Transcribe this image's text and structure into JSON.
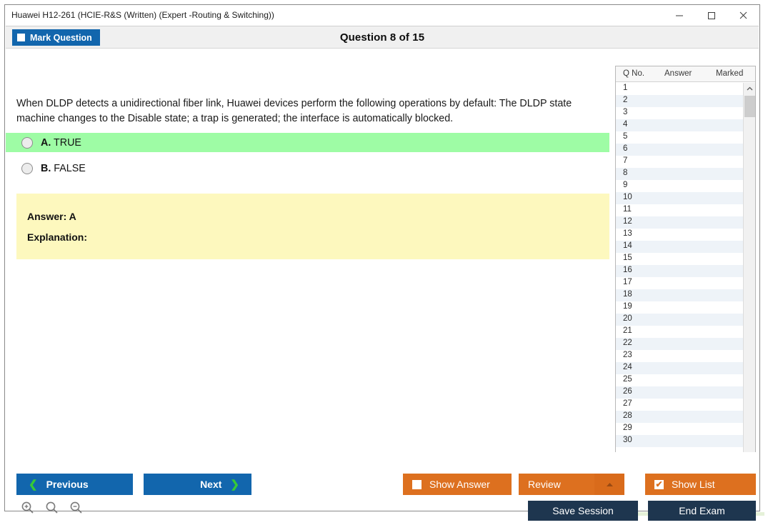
{
  "window": {
    "title": "Huawei H12-261 (HCIE-R&S (Written) (Expert -Routing & Switching))",
    "controls": {
      "minimize": "minimize-icon",
      "maximize": "maximize-icon",
      "close": "close-icon"
    }
  },
  "header": {
    "mark_question_label": "Mark Question",
    "question_counter": "Question 8 of 15"
  },
  "question": {
    "text": "When DLDP detects a unidirectional fiber link, Huawei devices perform the following operations by default: The DLDP state machine changes to the Disable state; a trap is generated; the interface is automatically blocked.",
    "options": [
      {
        "letter": "A.",
        "text": "TRUE",
        "selected": false,
        "highlight": "correct"
      },
      {
        "letter": "B.",
        "text": "FALSE",
        "selected": false,
        "highlight": "none"
      }
    ],
    "answer_line": "Answer: A",
    "explanation_line": "Explanation:"
  },
  "list_panel": {
    "columns": [
      "Q No.",
      "Answer",
      "Marked"
    ],
    "rows": [
      {
        "no": "1",
        "answer": "",
        "marked": ""
      },
      {
        "no": "2",
        "answer": "",
        "marked": ""
      },
      {
        "no": "3",
        "answer": "",
        "marked": ""
      },
      {
        "no": "4",
        "answer": "",
        "marked": ""
      },
      {
        "no": "5",
        "answer": "",
        "marked": ""
      },
      {
        "no": "6",
        "answer": "",
        "marked": ""
      },
      {
        "no": "7",
        "answer": "",
        "marked": ""
      },
      {
        "no": "8",
        "answer": "",
        "marked": ""
      },
      {
        "no": "9",
        "answer": "",
        "marked": ""
      },
      {
        "no": "10",
        "answer": "",
        "marked": ""
      },
      {
        "no": "11",
        "answer": "",
        "marked": ""
      },
      {
        "no": "12",
        "answer": "",
        "marked": ""
      },
      {
        "no": "13",
        "answer": "",
        "marked": ""
      },
      {
        "no": "14",
        "answer": "",
        "marked": ""
      },
      {
        "no": "15",
        "answer": "",
        "marked": ""
      },
      {
        "no": "16",
        "answer": "",
        "marked": ""
      },
      {
        "no": "17",
        "answer": "",
        "marked": ""
      },
      {
        "no": "18",
        "answer": "",
        "marked": ""
      },
      {
        "no": "19",
        "answer": "",
        "marked": ""
      },
      {
        "no": "20",
        "answer": "",
        "marked": ""
      },
      {
        "no": "21",
        "answer": "",
        "marked": ""
      },
      {
        "no": "22",
        "answer": "",
        "marked": ""
      },
      {
        "no": "23",
        "answer": "",
        "marked": ""
      },
      {
        "no": "24",
        "answer": "",
        "marked": ""
      },
      {
        "no": "25",
        "answer": "",
        "marked": ""
      },
      {
        "no": "26",
        "answer": "",
        "marked": ""
      },
      {
        "no": "27",
        "answer": "",
        "marked": ""
      },
      {
        "no": "28",
        "answer": "",
        "marked": ""
      },
      {
        "no": "29",
        "answer": "",
        "marked": ""
      },
      {
        "no": "30",
        "answer": "",
        "marked": ""
      }
    ],
    "scrollbar": {
      "up": "chevron-up-icon",
      "down": "chevron-down-icon"
    }
  },
  "footer": {
    "previous_label": "Previous",
    "next_label": "Next",
    "show_answer_label": "Show Answer",
    "show_answer_checked": false,
    "review_label": "Review",
    "show_list_label": "Show List",
    "show_list_checked": true,
    "show_list_check_glyph": "✔",
    "save_session_label": "Save Session",
    "end_exam_label": "End Exam",
    "zoom_tools": [
      "zoom-in-icon",
      "zoom-reset-icon",
      "zoom-out-icon"
    ]
  },
  "colors": {
    "accent_blue": "#1266ad",
    "accent_orange": "#dd701f",
    "navy": "#1e364f",
    "correct_green": "#9efca5",
    "answer_yellow": "#fdf8be",
    "chevron_green": "#36c936",
    "row_alt": "#eef3f8"
  }
}
